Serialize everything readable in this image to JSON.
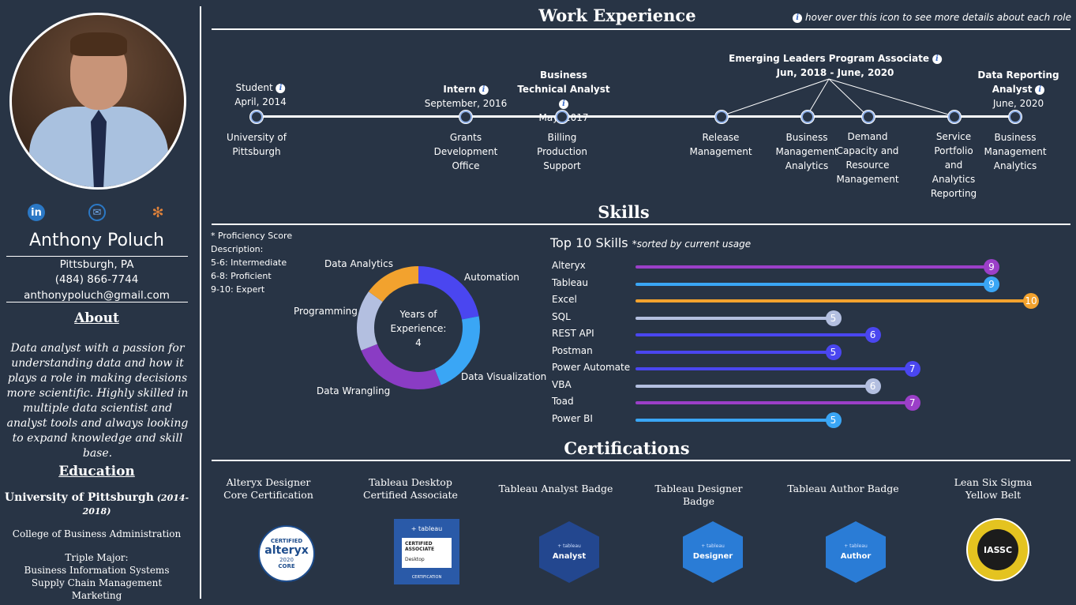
{
  "profile": {
    "name": "Anthony Poluch",
    "location": "Pittsburgh, PA",
    "phone": "(484) 866-7744",
    "email": "anthonypoluch@gmail.com"
  },
  "about": {
    "title": "About",
    "text": "Data analyst with a passion for understanding data and how it plays a role in making decisions more scientific. Highly skilled in multiple data scientist and analyst tools and always looking to expand knowledge and skill base."
  },
  "education": {
    "title": "Education",
    "school": "University of Pittsburgh",
    "years": "(2014-2018)",
    "college": "College of Business Administration",
    "major_heading": "Triple Major:",
    "majors": [
      "Business Information Systems",
      "Supply Chain Management",
      "Marketing"
    ]
  },
  "social": [
    {
      "icon": "linkedin-icon",
      "glyph": "in",
      "color": "#2b78c5"
    },
    {
      "icon": "mail-icon",
      "glyph": "✉",
      "color": "#2b78c5"
    },
    {
      "icon": "tableau-icon",
      "glyph": "✻",
      "color": "#e0823a"
    }
  ],
  "work": {
    "title": "Work Experience",
    "hint": "hover over this icon to see more details about each role",
    "roles": [
      {
        "title": "Student",
        "date": "April, 2014",
        "desc": "University of Pittsburgh"
      },
      {
        "title": "Intern",
        "date": "September, 2016",
        "desc": "Grants Development Office"
      },
      {
        "title": "Business Technical Analyst",
        "date": "May, 2017",
        "desc": "Billing Production Support"
      },
      {
        "title": "Emerging Leaders Program Associate",
        "date": "Jun, 2018 - June, 2020"
      },
      {
        "title": "Data Reporting Analyst",
        "date": "June, 2020",
        "desc": "Business Management Analytics"
      }
    ],
    "rotations": [
      "Release Management",
      "Business Management Analytics",
      "Demand Capacity and Resource Management",
      "Service Portfolio and Analytics Reporting"
    ]
  },
  "skills": {
    "title": "Skills",
    "note": [
      "* Proficiency Score",
      "Description:",
      "5-6: Intermediate",
      "6-8: Proficient",
      "9-10: Expert"
    ],
    "donut_center": [
      "Years of",
      "Experience:",
      "4"
    ],
    "top_title": "Top 10 Skills",
    "top_subtitle": "*sorted by current usage"
  },
  "chart_data": [
    {
      "type": "pie",
      "title": "Years of Experience: 4",
      "categories": [
        "Automation",
        "Data Visualization",
        "Data Wrangling",
        "Programming",
        "Data Analytics"
      ],
      "values": [
        22,
        22,
        25,
        16,
        15
      ],
      "colors": [
        "#4a46f0",
        "#3aa6f5",
        "#8a3cc4",
        "#b3bfe0",
        "#f2a22e"
      ]
    },
    {
      "type": "bar",
      "categories": [
        "Alteryx",
        "Tableau",
        "Excel",
        "SQL",
        "REST API",
        "Postman",
        "Power Automate",
        "VBA",
        "Toad",
        "Power BI"
      ],
      "values": [
        9,
        9,
        10,
        5,
        6,
        5,
        7,
        6,
        7,
        5
      ],
      "colors": [
        "#9b3fc8",
        "#3aa6f5",
        "#f2a22e",
        "#b3bfe0",
        "#4a46f0",
        "#4a46f0",
        "#4a46f0",
        "#b3bfe0",
        "#9b3fc8",
        "#3aa6f5"
      ],
      "xlim": [
        0,
        10
      ]
    }
  ],
  "certifications": {
    "title": "Certifications",
    "items": [
      {
        "name": "Alteryx Designer Core Certification",
        "badge_text": "alteryx",
        "badge_sub": "CERTIFIED",
        "badge_year": "2020",
        "badge_core": "CORE"
      },
      {
        "name": "Tableau Desktop Certified Associate",
        "badge_text": "+ tableau",
        "badge_sub": "CERTIFIED ASSOCIATE",
        "badge_desk": "Desktop",
        "badge_foot": "CERTIFICATION"
      },
      {
        "name": "Tableau Analyst Badge",
        "badge_text": "Analyst",
        "badge_sub": "+ tableau"
      },
      {
        "name": "Tableau Designer Badge",
        "badge_text": "Designer",
        "badge_sub": "+ tableau"
      },
      {
        "name": "Tableau Author Badge",
        "badge_text": "Author",
        "badge_sub": "+ tableau"
      },
      {
        "name": "Lean Six Sigma Yellow Belt",
        "badge_text": "IASSC"
      }
    ]
  }
}
